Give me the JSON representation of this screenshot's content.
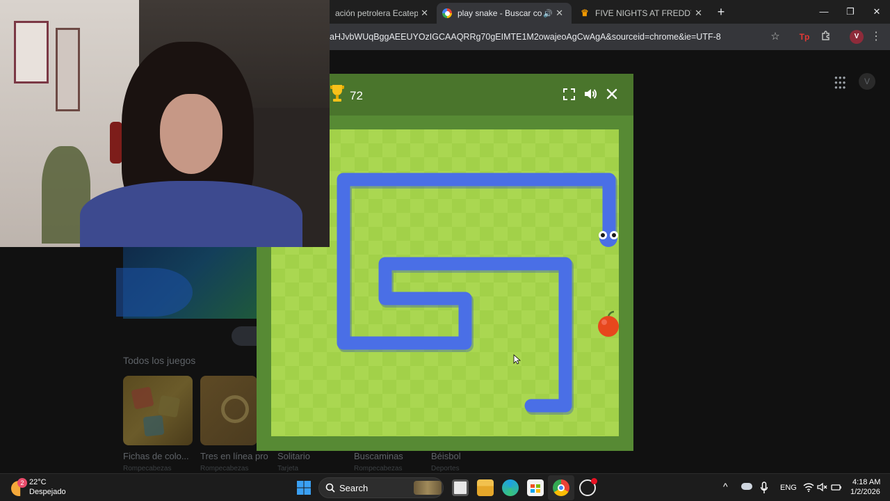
{
  "browser": {
    "tabs": [
      {
        "title": "ación petrolera Ecatepec",
        "icon": "none",
        "active": false
      },
      {
        "title": "play snake - Buscar con Go",
        "icon": "google-icon",
        "active": true
      },
      {
        "title": "FIVE NIGHTS AT FREDDY'S jueg",
        "icon": "crown-icon",
        "active": false
      }
    ],
    "new_tab": "+",
    "close_glyph": "✕",
    "minimize": "—",
    "maximize": "❐",
    "close_window": "✕",
    "url": "aHJvbWUqBggAEEUYOzIGCAAQRRg70gEIMTE1M2owajeoAgCwAgA&sourceid=chrome&ie=UTF-8",
    "star": "☆",
    "ext_tp": "Tp",
    "profile_initial": "V",
    "menu": "⋮"
  },
  "google": {
    "apps_icon": "⋮⋮⋮",
    "profile_initial": "V",
    "section_title": "Todos los juegos",
    "games": [
      {
        "name": "Fichas de colo...",
        "category": "Rompecabezas"
      },
      {
        "name": "Tres en línea pro",
        "category": "Rompecabezas"
      },
      {
        "name": "Solitario",
        "category": "Tarjeta"
      },
      {
        "name": "Buscaminas",
        "category": "Rompecabezas"
      },
      {
        "name": "Béisbol",
        "category": "Deportes"
      }
    ]
  },
  "game": {
    "score": "72",
    "icons": [
      "trophy-icon",
      "fullscreen-icon",
      "volume-icon",
      "close-icon"
    ],
    "colors": {
      "snake": "#4a6fe6",
      "snake_shadow": "#2f4ebd",
      "board_light": "#aad751",
      "board_dark": "#a2d149",
      "frame": "#578a34",
      "header": "#4a752c",
      "apple": "#e7471d"
    }
  },
  "taskbar": {
    "weather_temp": "22°C",
    "weather_desc": "Despejado",
    "weather_badge": "2",
    "search_label": "Search",
    "lang": "ENG",
    "time": "4:18 AM",
    "date": "1/2/2026",
    "chevron": "^"
  }
}
